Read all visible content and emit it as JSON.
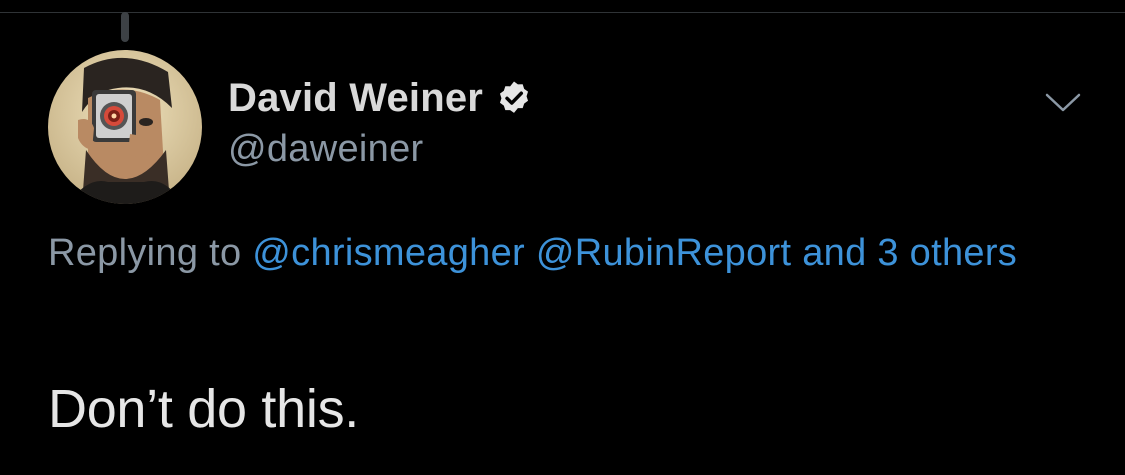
{
  "tweet": {
    "author": {
      "display_name": "David Weiner",
      "handle": "@daweiner",
      "verified": true,
      "verified_icon": "verified-badge-icon",
      "avatar_icon": "avatar-photo"
    },
    "menu_icon": "chevron-down-icon",
    "reply_context": {
      "prefix": "Replying to",
      "mentions": [
        "@chrismeagher",
        "@RubinReport"
      ],
      "others": "and 3 others"
    },
    "text": "Don’t do this."
  },
  "colors": {
    "background": "#000000",
    "primary_text": "#d9d9d9",
    "secondary_text": "#8b98a5",
    "link": "#3d92d9",
    "divider": "#2f3336"
  }
}
